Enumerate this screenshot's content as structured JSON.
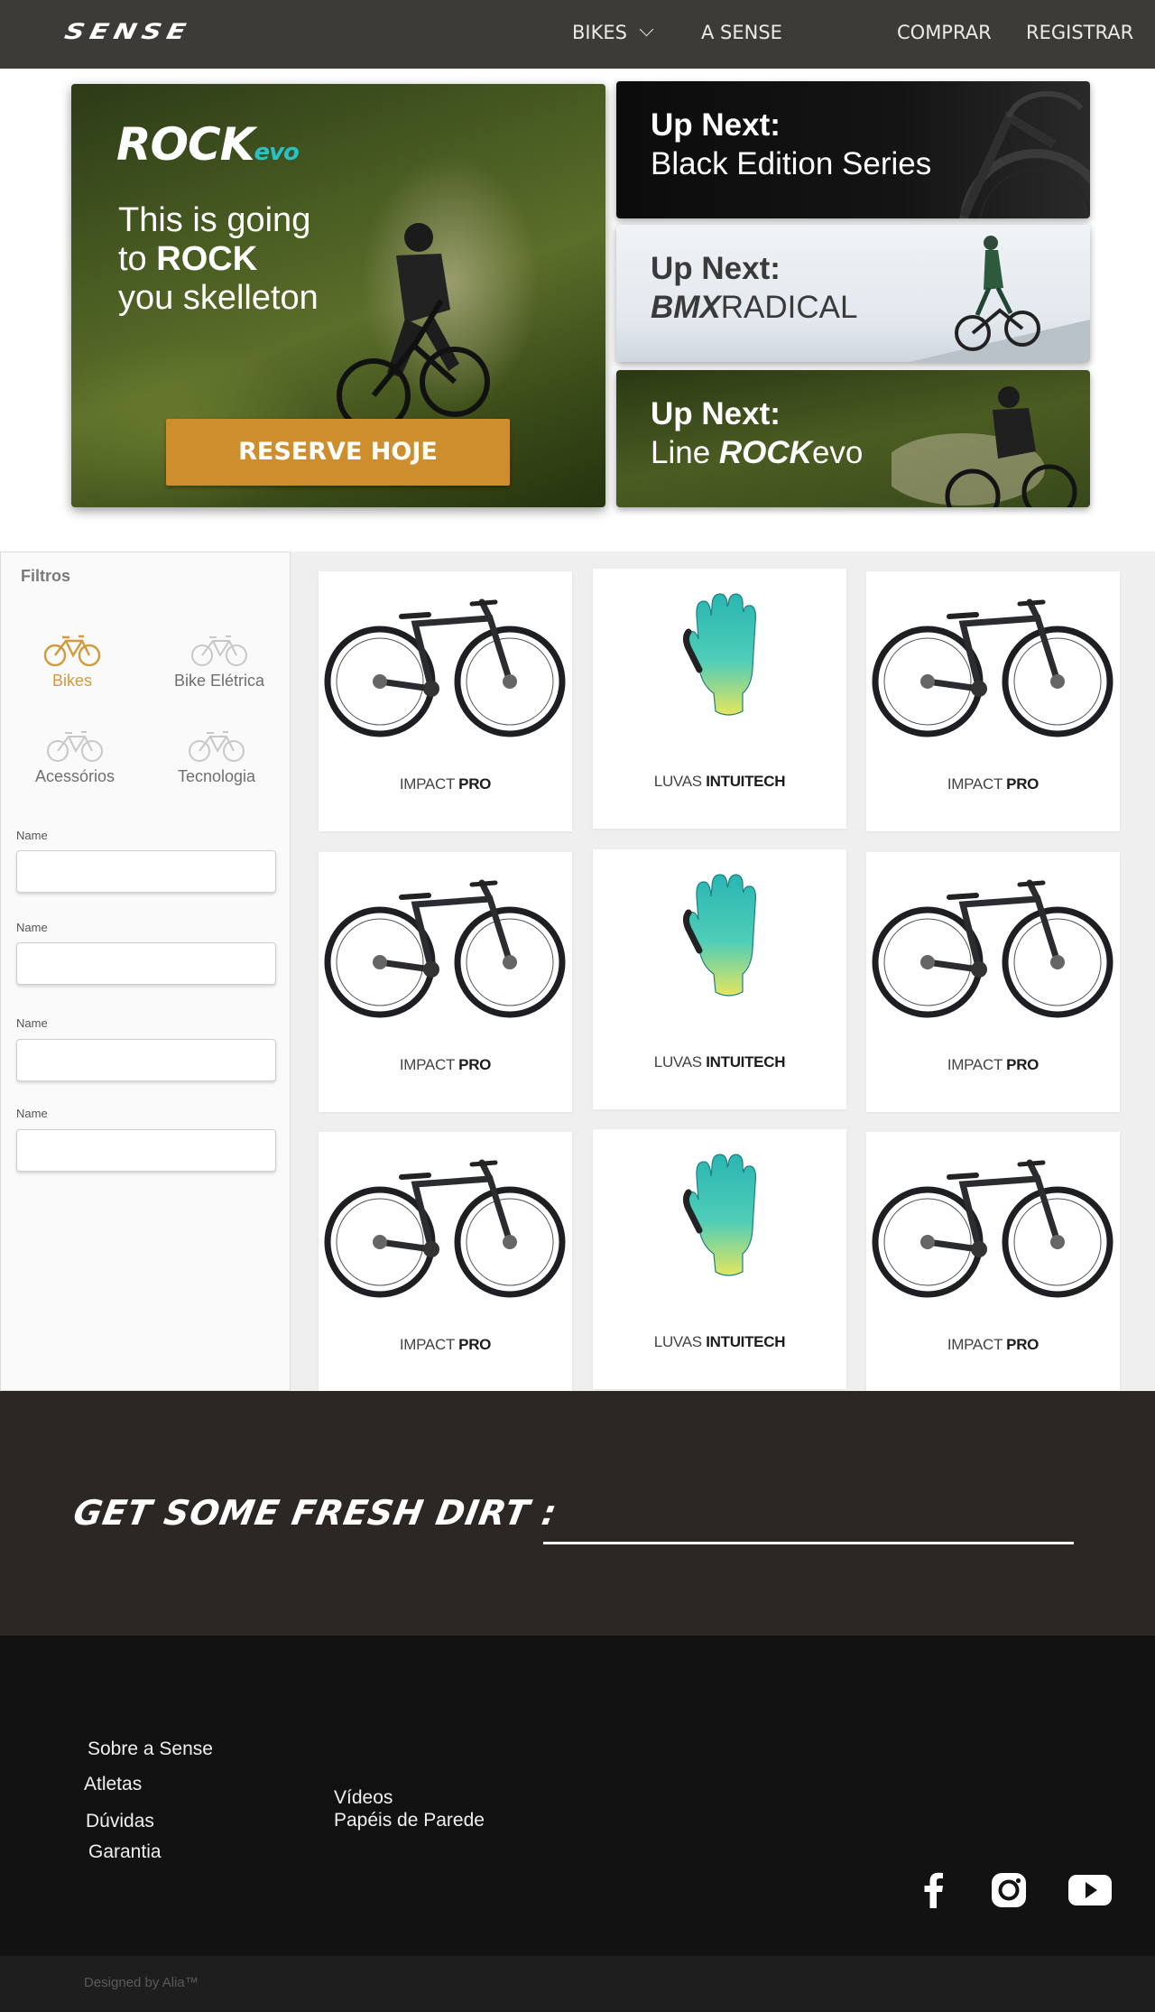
{
  "nav": {
    "logo": "SENSE",
    "bikes": "BIKES",
    "a_sense": "A SENSE",
    "comprar": "COMPRAR",
    "registrar": "REGISTRAR"
  },
  "hero": {
    "brand": "ROCK",
    "brand_suffix": "evo",
    "tagline_1": "This is going",
    "tagline_2a": "to ",
    "tagline_2b": "ROCK",
    "tagline_3": "you skelleton",
    "cta": "RESERVE HOJE"
  },
  "up_next": [
    {
      "title": "Up Next:",
      "sub_plain": "Black Edition Series"
    },
    {
      "title": "Up Next:",
      "sub_bold": "BMX",
      "sub_plain": "RADICAL"
    },
    {
      "title": "Up Next:",
      "sub_pre": "Line ",
      "sub_bold": "ROCK",
      "sub_plain": "evo"
    }
  ],
  "filters": {
    "title": "Filtros",
    "categories": [
      {
        "label": "Bikes",
        "icon": "bicycle-icon",
        "active": true
      },
      {
        "label": "Bike Elétrica",
        "icon": "bicycle-icon",
        "active": false
      },
      {
        "label": "Acessórios",
        "icon": "bicycle-icon",
        "active": false
      },
      {
        "label": "Tecnologia",
        "icon": "bicycle-icon",
        "active": false
      }
    ],
    "fields": [
      {
        "label": "Name",
        "value": ""
      },
      {
        "label": "Name",
        "value": ""
      },
      {
        "label": "Name",
        "value": ""
      },
      {
        "label": "Name",
        "value": ""
      }
    ]
  },
  "products": [
    {
      "name_light": "IMPACT ",
      "name_bold": "PRO",
      "type": "bike"
    },
    {
      "name_light": "LUVAS ",
      "name_bold": "INTUITECH",
      "type": "glove"
    },
    {
      "name_light": "IMPACT ",
      "name_bold": "PRO",
      "type": "bike"
    },
    {
      "name_light": "IMPACT ",
      "name_bold": "PRO",
      "type": "bike"
    },
    {
      "name_light": "LUVAS ",
      "name_bold": "INTUITECH",
      "type": "glove"
    },
    {
      "name_light": "IMPACT ",
      "name_bold": "PRO",
      "type": "bike"
    },
    {
      "name_light": "IMPACT ",
      "name_bold": "PRO",
      "type": "bike"
    },
    {
      "name_light": "LUVAS ",
      "name_bold": "INTUITECH",
      "type": "glove"
    },
    {
      "name_light": "IMPACT ",
      "name_bold": "PRO",
      "type": "bike"
    }
  ],
  "newsletter": {
    "text": "GET SOME FRESH DIRT :",
    "value": ""
  },
  "footer": {
    "links_left": [
      "Sobre a Sense",
      "Atletas",
      "Dúvidas",
      "Garantia"
    ],
    "links_right": [
      "Vídeos",
      "Papéis de Parede"
    ],
    "social": [
      "facebook-icon",
      "instagram-icon",
      "youtube-icon"
    ],
    "credit": "Designed by Alia™"
  },
  "colors": {
    "nav_bg": "#3d3b38",
    "accent_orange": "#cf8e2e",
    "active_filter": "#d39a3c",
    "evo_teal": "#27c1c6",
    "newsletter_bg": "#2c2723",
    "footer_bg": "#131213"
  }
}
